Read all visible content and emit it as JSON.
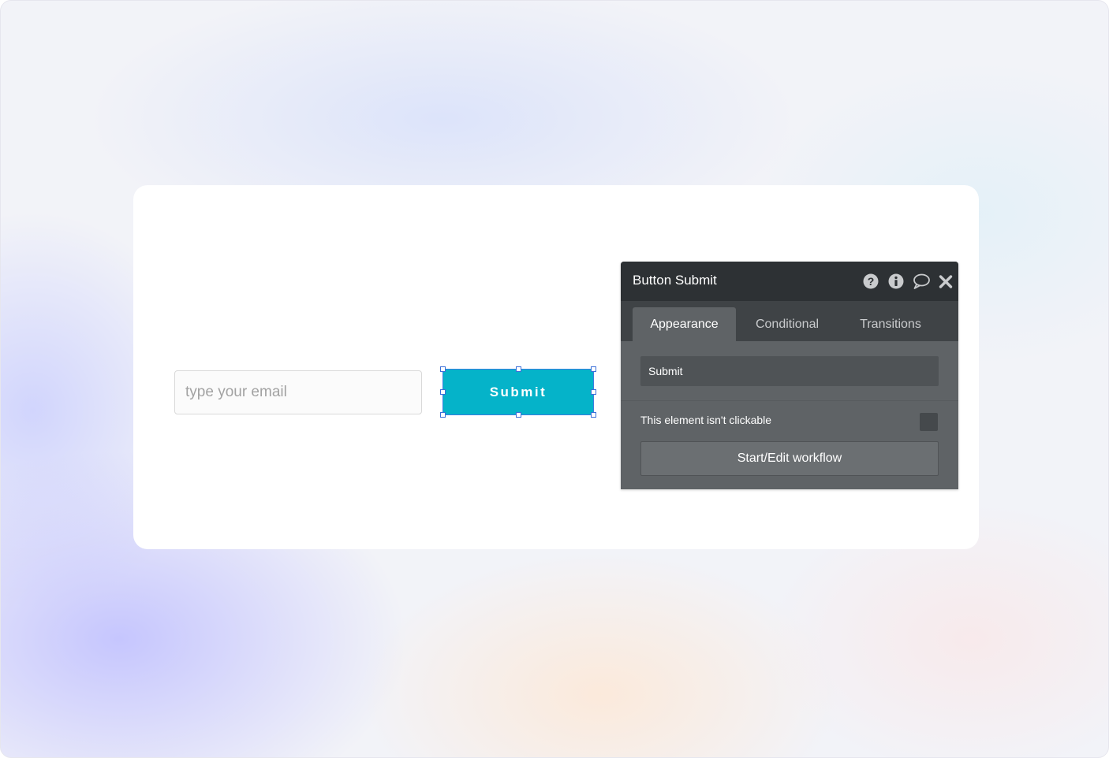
{
  "canvas": {
    "email_input": {
      "placeholder": "type your email",
      "value": ""
    },
    "submit_button": {
      "label": "Submit",
      "color": "#05b3c9"
    }
  },
  "property_panel": {
    "title": "Button Submit",
    "header_icons": [
      "help-icon",
      "info-icon",
      "comment-icon",
      "close-icon"
    ],
    "tabs": [
      {
        "label": "Appearance",
        "active": true
      },
      {
        "label": "Conditional",
        "active": false
      },
      {
        "label": "Transitions",
        "active": false
      }
    ],
    "text_field_value": "Submit",
    "not_clickable_label": "This element isn't clickable",
    "not_clickable_checked": false,
    "workflow_button_label": "Start/Edit workflow"
  }
}
